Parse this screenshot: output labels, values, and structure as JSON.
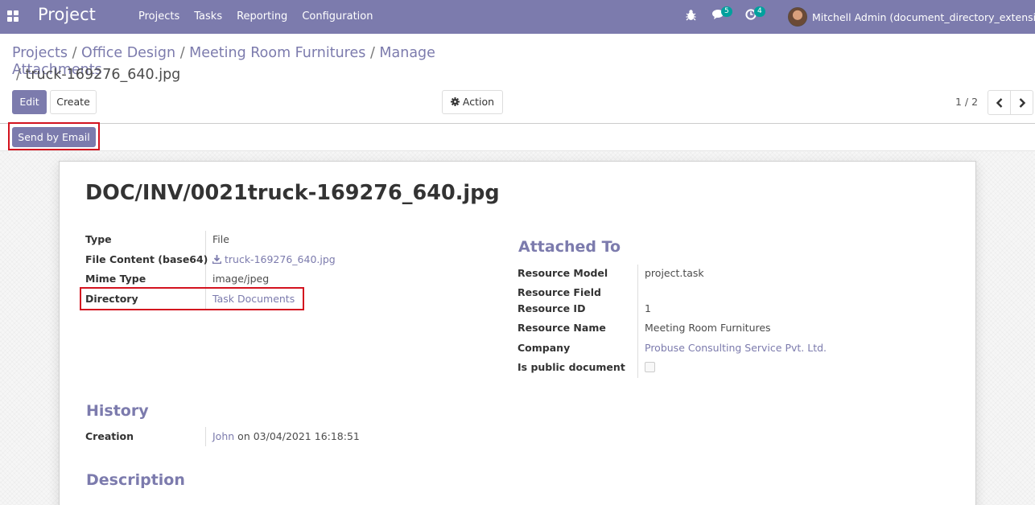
{
  "navbar": {
    "brand": "Project",
    "menu": [
      "Projects",
      "Tasks",
      "Reporting",
      "Configuration"
    ],
    "chat_count": "5",
    "activity_count": "4",
    "user_name": "Mitchell Admin (document_directory_extension)"
  },
  "breadcrumb": {
    "items": [
      "Projects",
      "Office Design",
      "Meeting Room Furnitures",
      "Manage Attachments"
    ],
    "current": "truck-169276_640.jpg"
  },
  "buttons": {
    "edit": "Edit",
    "create": "Create",
    "action": "Action",
    "send_by_email": "Send by Email"
  },
  "pager": {
    "value": "1 / 2"
  },
  "record": {
    "title": "DOC/INV/0021truck-169276_640.jpg",
    "fields": [
      {
        "label": "Type",
        "value": "File"
      },
      {
        "label": "File Content (base64)",
        "value": "truck-169276_640.jpg"
      },
      {
        "label": "Mime Type",
        "value": "image/jpeg"
      },
      {
        "label": "Directory",
        "value": "Task Documents"
      }
    ],
    "attached_to": {
      "title": "Attached To",
      "fields": [
        {
          "label": "Resource Model",
          "value": "project.task"
        },
        {
          "label": "Resource Field",
          "value": ""
        },
        {
          "label": "Resource ID",
          "value": "1"
        },
        {
          "label": "Resource Name",
          "value": "Meeting Room Furnitures"
        },
        {
          "label": "Company",
          "value": "Probuse Consulting Service Pvt. Ltd."
        },
        {
          "label": "Is public document",
          "value": ""
        }
      ]
    },
    "history": {
      "title": "History",
      "creation_label": "Creation",
      "creator": "John",
      "creation_on": "on 03/04/2021 16:18:51"
    },
    "description": {
      "title": "Description"
    }
  },
  "colors": {
    "brand": "#7c7bad",
    "highlight": "#d3131f",
    "badge": "#00a09d"
  }
}
